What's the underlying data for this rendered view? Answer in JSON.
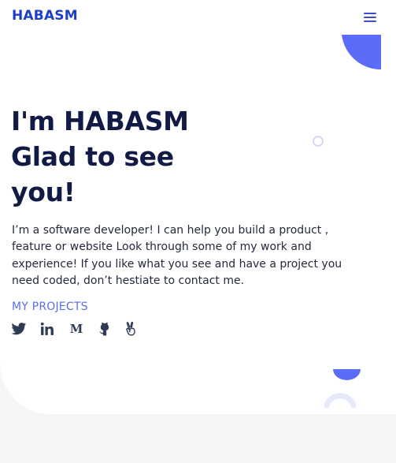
{
  "header": {
    "logo": "HABASM"
  },
  "hero": {
    "headline_lines": [
      "I'm HABASM",
      "Glad to see",
      "you!"
    ],
    "intro": "I’m a software developer! I can help you build a product , feature or website Look through some of my work and experience! If you like what you see and have a project you need coded, don’t hestiate to contact me.",
    "projects_link": "MY PROJECTS"
  },
  "socials": [
    {
      "icon": "twitter-icon"
    },
    {
      "icon": "linkedin-icon"
    },
    {
      "icon": "medium-icon"
    },
    {
      "icon": "github-icon"
    },
    {
      "icon": "angellist-icon"
    }
  ],
  "colors": {
    "brand": "#1e3ec9",
    "accent": "#5a6fe0",
    "decor": "#5b6df8",
    "headline": "#111b45",
    "social": "#2f3a54",
    "footer_bg": "#f6f6f9"
  }
}
